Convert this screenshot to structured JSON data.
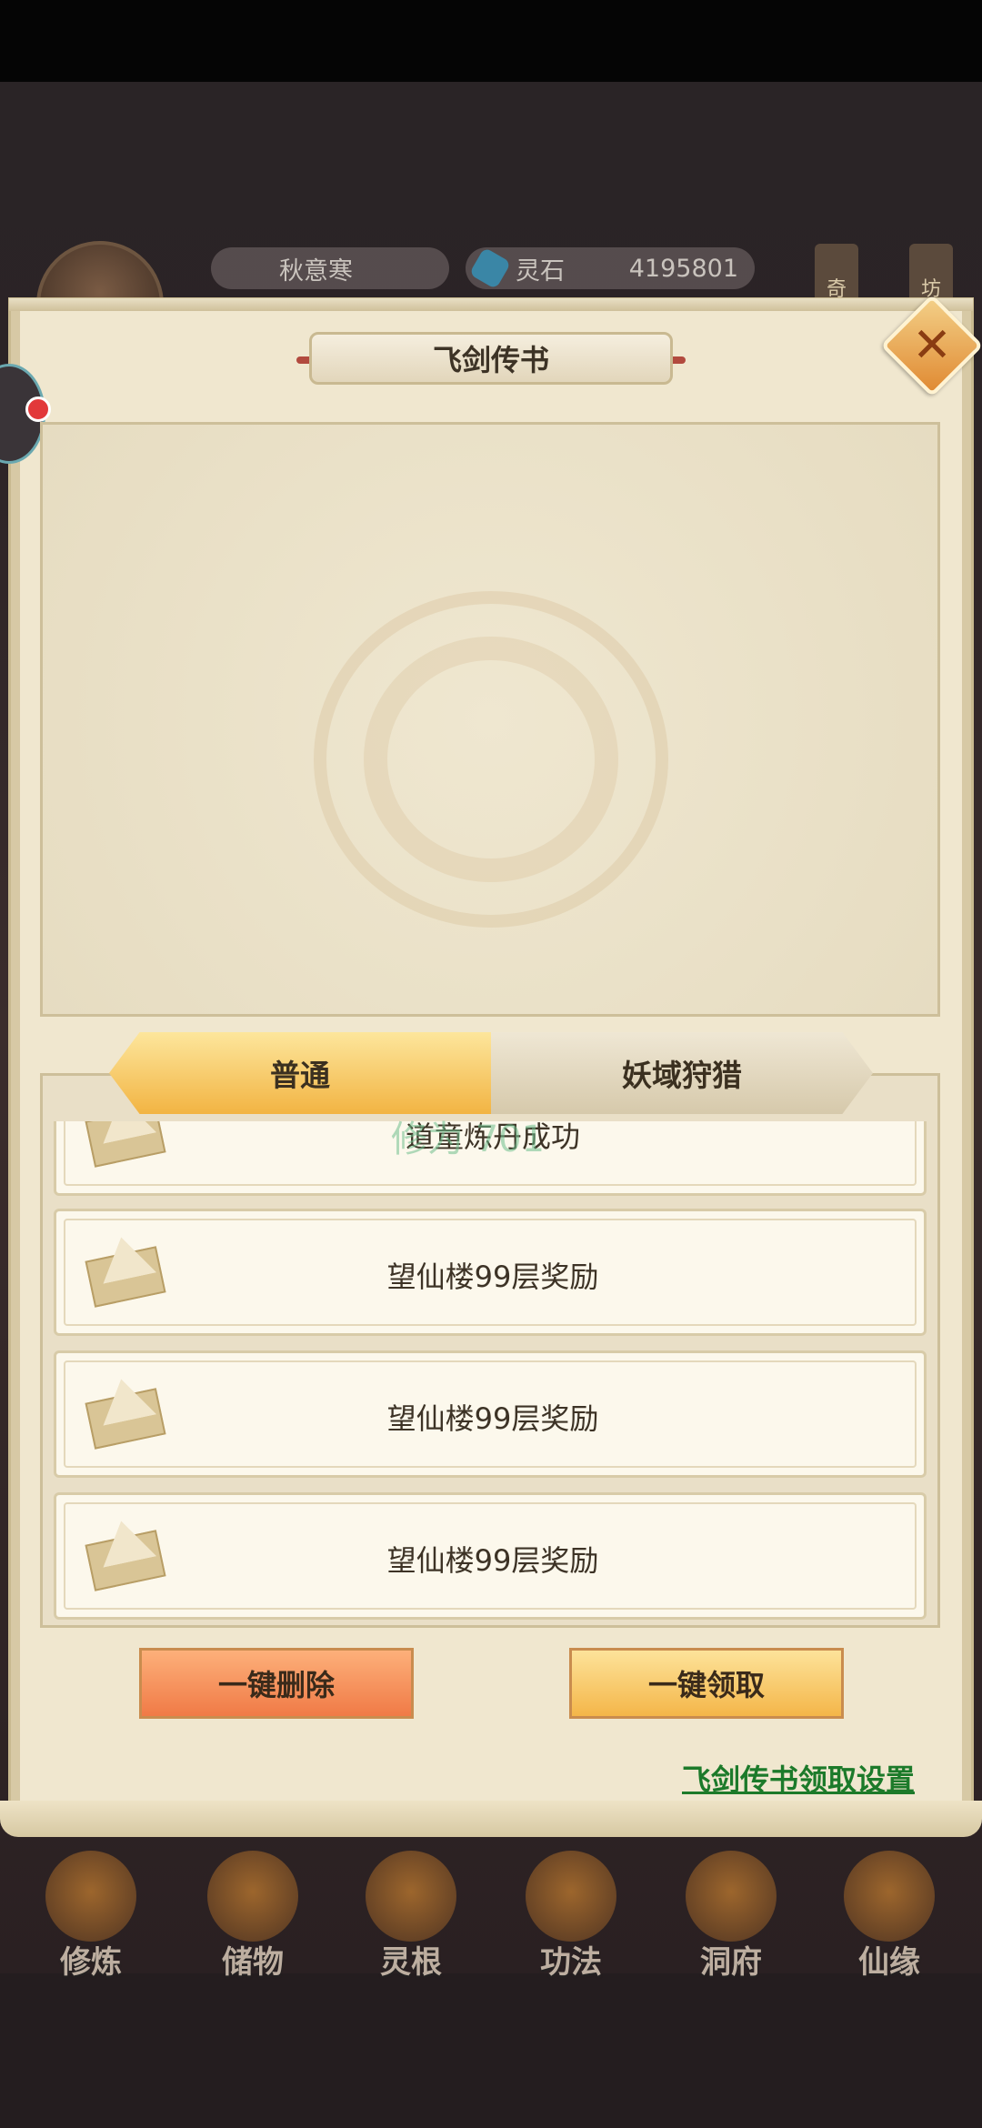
{
  "hud": {
    "player_name": "秋意寒",
    "stone_label": "灵石",
    "stone_value": "4195801",
    "tag_left": "奇",
    "tag_right": "坊"
  },
  "nav": [
    {
      "label": "修炼",
      "icon": "cultivate-icon"
    },
    {
      "label": "储物",
      "icon": "storage-bag-icon"
    },
    {
      "label": "灵根",
      "icon": "spirit-root-icon"
    },
    {
      "label": "功法",
      "icon": "technique-book-icon"
    },
    {
      "label": "洞府",
      "icon": "cave-house-icon"
    },
    {
      "label": "仙缘",
      "icon": "immortal-fate-icon"
    }
  ],
  "panel": {
    "title": "飞剑传书",
    "tabs": [
      {
        "label": "普通",
        "active": true
      },
      {
        "label": "妖域狩猎",
        "active": false
      }
    ],
    "mails": [
      {
        "title": "道童炼丹成功"
      },
      {
        "title": "望仙楼99层奖励"
      },
      {
        "title": "望仙楼99层奖励"
      },
      {
        "title": "望仙楼99层奖励"
      }
    ],
    "watermark": "修为 701",
    "buttons": {
      "delete_all": "一键删除",
      "claim_all": "一键领取"
    },
    "settings_link": "飞剑传书领取设置"
  },
  "colors": {
    "panel_bg": "#f0e7cf",
    "tab_active": "#f2b443",
    "delete_button": "#f07a46",
    "claim_button": "#f4b649",
    "link": "#1c7a2a"
  }
}
